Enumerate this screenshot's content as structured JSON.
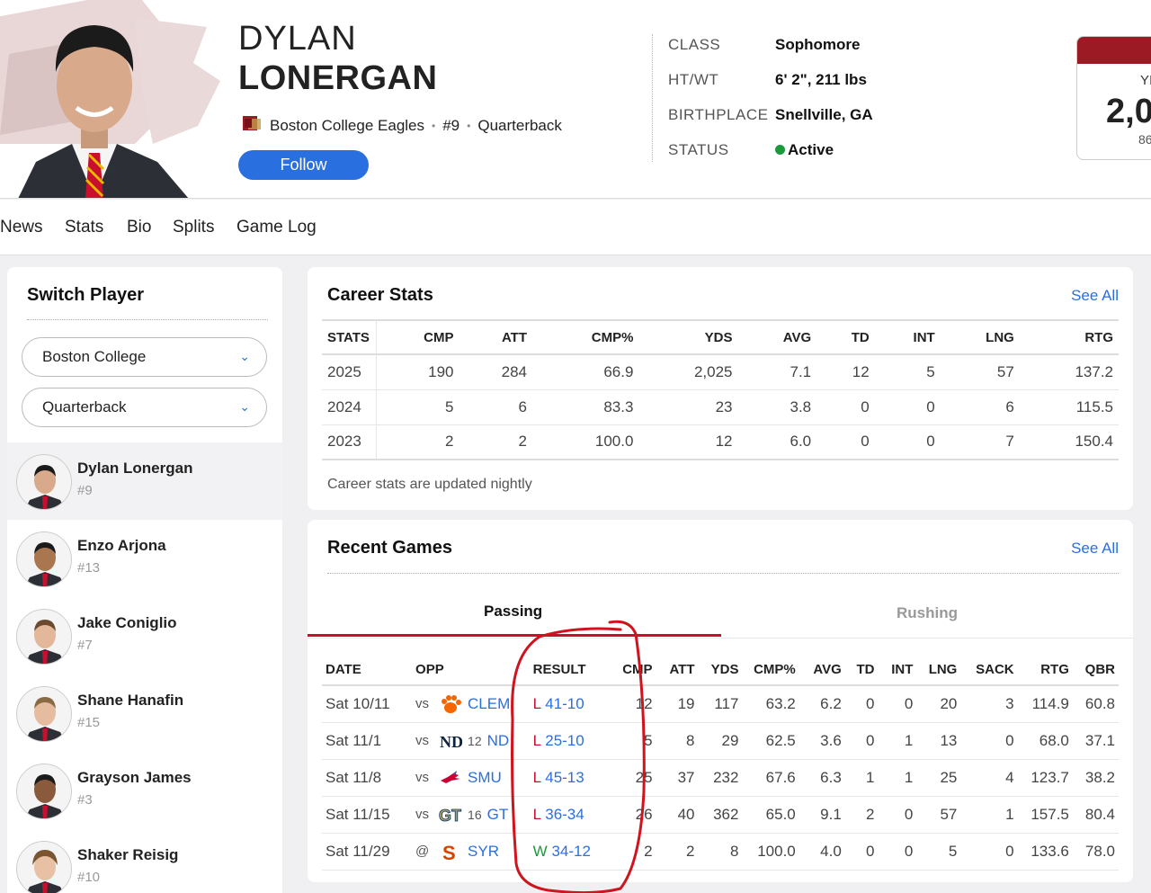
{
  "player": {
    "first_name": "DYLAN",
    "last_name": "LONERGAN",
    "team": "Boston College Eagles",
    "number": "#9",
    "position": "Quarterback",
    "follow_label": "Follow"
  },
  "bio": [
    {
      "key": "CLASS",
      "value": "Sophomore"
    },
    {
      "key": "HT/WT",
      "value": "6' 2\", 211 lbs"
    },
    {
      "key": "BIRTHPLACE",
      "value": "Snellville, GA"
    },
    {
      "key": "STATUS",
      "value": "Active"
    }
  ],
  "stat_card": {
    "label": "YI",
    "value": "2,0",
    "sub": "86"
  },
  "nav": [
    "News",
    "Stats",
    "Bio",
    "Splits",
    "Game Log"
  ],
  "sidebar": {
    "title": "Switch Player",
    "team_select": "Boston College",
    "position_select": "Quarterback",
    "players": [
      {
        "name": "Dylan Lonergan",
        "number": "#9"
      },
      {
        "name": "Enzo Arjona",
        "number": "#13"
      },
      {
        "name": "Jake Coniglio",
        "number": "#7"
      },
      {
        "name": "Shane Hanafin",
        "number": "#15"
      },
      {
        "name": "Grayson James",
        "number": "#3"
      },
      {
        "name": "Shaker Reisig",
        "number": "#10"
      }
    ]
  },
  "career": {
    "title": "Career Stats",
    "see_all": "See All",
    "headers": [
      "STATS",
      "CMP",
      "ATT",
      "CMP%",
      "YDS",
      "AVG",
      "TD",
      "INT",
      "LNG",
      "RTG"
    ],
    "rows": [
      [
        "2025",
        "190",
        "284",
        "66.9",
        "2,025",
        "7.1",
        "12",
        "5",
        "57",
        "137.2"
      ],
      [
        "2024",
        "5",
        "6",
        "83.3",
        "23",
        "3.8",
        "0",
        "0",
        "6",
        "115.5"
      ],
      [
        "2023",
        "2",
        "2",
        "100.0",
        "12",
        "6.0",
        "0",
        "0",
        "7",
        "150.4"
      ]
    ],
    "note": "Career stats are updated nightly"
  },
  "recent": {
    "title": "Recent Games",
    "see_all": "See All",
    "tabs": [
      "Passing",
      "Rushing"
    ],
    "headers": [
      "DATE",
      "OPP",
      "RESULT",
      "CMP",
      "ATT",
      "YDS",
      "CMP%",
      "AVG",
      "TD",
      "INT",
      "LNG",
      "SACK",
      "RTG",
      "QBR"
    ],
    "games": [
      {
        "date": "Sat 10/11",
        "vs": "vs",
        "rank": "",
        "opp": "CLEM",
        "wl": "L",
        "score": "41-10",
        "stats": [
          "12",
          "19",
          "117",
          "63.2",
          "6.2",
          "0",
          "0",
          "20",
          "3",
          "114.9",
          "60.8"
        ]
      },
      {
        "date": "Sat 11/1",
        "vs": "vs",
        "rank": "12",
        "opp": "ND",
        "wl": "L",
        "score": "25-10",
        "stats": [
          "5",
          "8",
          "29",
          "62.5",
          "3.6",
          "0",
          "1",
          "13",
          "0",
          "68.0",
          "37.1"
        ]
      },
      {
        "date": "Sat 11/8",
        "vs": "vs",
        "rank": "",
        "opp": "SMU",
        "wl": "L",
        "score": "45-13",
        "stats": [
          "25",
          "37",
          "232",
          "67.6",
          "6.3",
          "1",
          "1",
          "25",
          "4",
          "123.7",
          "38.2"
        ]
      },
      {
        "date": "Sat 11/15",
        "vs": "vs",
        "rank": "16",
        "opp": "GT",
        "wl": "L",
        "score": "36-34",
        "stats": [
          "26",
          "40",
          "362",
          "65.0",
          "9.1",
          "2",
          "0",
          "57",
          "1",
          "157.5",
          "80.4"
        ]
      },
      {
        "date": "Sat 11/29",
        "vs": "@",
        "rank": "",
        "opp": "SYR",
        "wl": "W",
        "score": "34-12",
        "stats": [
          "2",
          "2",
          "8",
          "100.0",
          "4.0",
          "0",
          "0",
          "5",
          "0",
          "133.6",
          "78.0"
        ]
      }
    ]
  },
  "colors": {
    "accent": "#2a6fe0",
    "brand": "#9c1a24",
    "loss": "#c8102e",
    "win": "#1a9a3a",
    "annotation": "#d0141e"
  }
}
